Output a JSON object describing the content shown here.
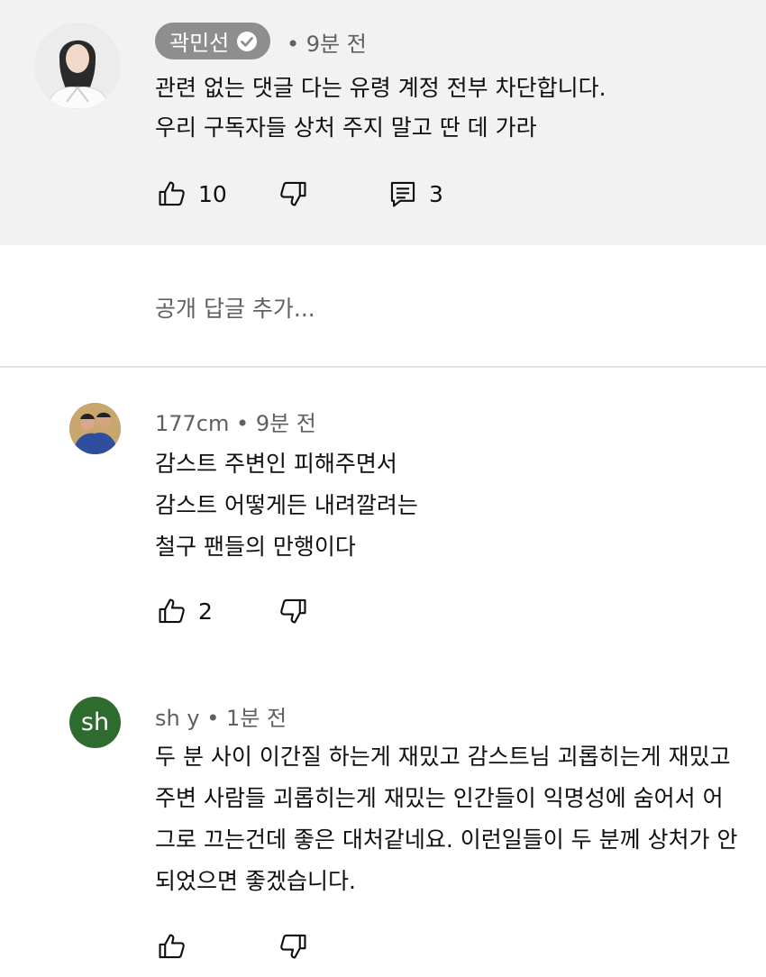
{
  "pinned_comment": {
    "author": "곽민선",
    "time": "• 9분 전",
    "lines": [
      "관련 없는 댓글 다는 유령 계정 전부 차단합니다.",
      "우리 구독자들 상처 주지 말고 딴 데 가라"
    ],
    "likes": "10",
    "replies": "3"
  },
  "reply_box": {
    "placeholder": "공개 답글 추가..."
  },
  "comments": [
    {
      "author": "177cm",
      "time": "• 9분 전",
      "lines": [
        "감스트 주변인 피해주면서",
        "감스트 어떻게든 내려깔려는",
        "철구 팬들의 만행이다"
      ],
      "likes": "2"
    },
    {
      "author": "sh y",
      "time": "• 1분 전",
      "avatar_letter": "sh",
      "lines": [
        "두 분 사이 이간질 하는게 재밌고 감스트님 괴롭히는게 재밌고",
        "주변 사람들 괴롭히는게 재밌는 인간들이 익명성에 숨어서 어",
        "그로 끄는건데 좋은 대처같네요. 이런일들이 두 분께 상처가 안",
        "되었으면 좋겠습니다."
      ]
    }
  ],
  "icons": {
    "like": "thumbs-up-icon",
    "dislike": "thumbs-down-icon",
    "reply": "reply-icon",
    "verified": "verified-check-icon"
  },
  "colors": {
    "pinned_bg": "#f2f2f2",
    "pill_bg": "#8e8e8e",
    "meta_text": "#606060",
    "avatar_sh": "#2e6b2f"
  }
}
